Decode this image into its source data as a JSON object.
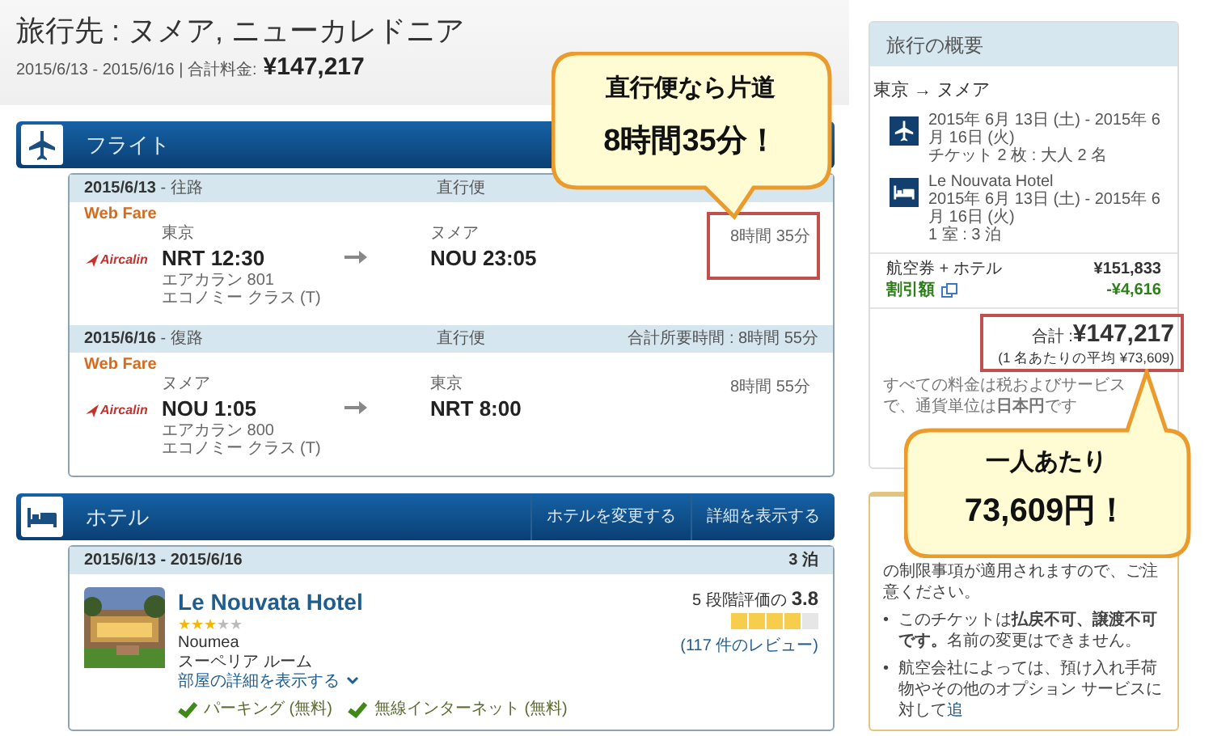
{
  "header": {
    "title": "旅行先 : ヌメア, ニューカレドニア",
    "dates": "2015/6/13 - 2015/6/16 | 合計料金:",
    "total": "¥147,217"
  },
  "flight_section": {
    "title": "フライト",
    "legs": [
      {
        "date": "2015/6/13",
        "direction": " - 往路",
        "type": "直行便",
        "fare": "Web Fare",
        "airline": "Aircalin",
        "from_city": "東京",
        "from": "NRT 12:30",
        "flight": "エアカラン 801",
        "cabin": "エコノミー クラス (T)",
        "to_city": "ヌメア",
        "to": "NOU 23:05",
        "duration": "8時間 35分",
        "highlighted": true
      },
      {
        "date": "2015/6/16",
        "direction": " - 復路",
        "type": "直行便",
        "total_duration": "合計所要時間 : 8時間 55分",
        "fare": "Web Fare",
        "airline": "Aircalin",
        "from_city": "ヌメア",
        "from": "NOU 1:05",
        "flight": "エアカラン 800",
        "cabin": "エコノミー クラス (T)",
        "to_city": "東京",
        "to": "NRT 8:00",
        "duration": "8時間 55分",
        "highlighted": false
      }
    ]
  },
  "hotel_section": {
    "title": "ホテル",
    "buttons": [
      "ホテルを変更する",
      "詳細を表示する"
    ],
    "dates": "2015/6/13 - 2015/6/16",
    "nights": "3 泊",
    "name": "Le Nouvata Hotel",
    "stars": 3,
    "city": "Noumea",
    "room": "スーペリア ルーム",
    "details_link": "部屋の詳細を表示する",
    "rating": {
      "label": "5 段階評価の",
      "value": "3.8",
      "stars": 4,
      "reviews": "(117 件のレビュー)"
    },
    "amenities": [
      "パーキング (無料)",
      "無線インターネット (無料)"
    ]
  },
  "sidebar": {
    "title": "旅行の概要",
    "route": "東京 → ヌメア",
    "items": [
      {
        "kind": "flight",
        "lines": [
          "2015年 6月 13日 (土) - 2015年 6月 16日 (火)",
          "チケット 2 枚 : 大人 2 名"
        ]
      },
      {
        "kind": "hotel",
        "lines": [
          "Le Nouvata Hotel",
          "2015年 6月 13日 (土) - 2015年 6月 16日 (火)",
          "1 室 : 3 泊"
        ]
      }
    ],
    "price_rows": [
      {
        "kind": "normal",
        "label": "航空券 + ホテル",
        "value": "¥151,833"
      },
      {
        "kind": "discount",
        "label": "割引額",
        "value": "-¥4,616"
      }
    ],
    "total_label": "合計 :",
    "total": "¥147,217",
    "average": "(1 名あたりの平均 ¥73,609)",
    "highlighted": true,
    "note_parts": [
      "すべての料金は税およびサービス",
      "で、通貨単位は**日本円**です"
    ]
  },
  "notice": {
    "text": "の制限事項が適用されますので、ご注意ください。",
    "bullets": [
      {
        "marker": "•",
        "text": "このチケットは**払戻不可、譲渡不可です。**名前の変更はできません。"
      },
      {
        "marker": "•",
        "text": "航空会社によっては、預け入れ手荷物やその他のオプション サービスに対して",
        "link": "追"
      }
    ]
  },
  "callouts": [
    {
      "lines": [
        "直行便なら片道",
        "8時間35分！"
      ]
    },
    {
      "lines": [
        "一人あたり",
        "73,609円！"
      ]
    }
  ]
}
